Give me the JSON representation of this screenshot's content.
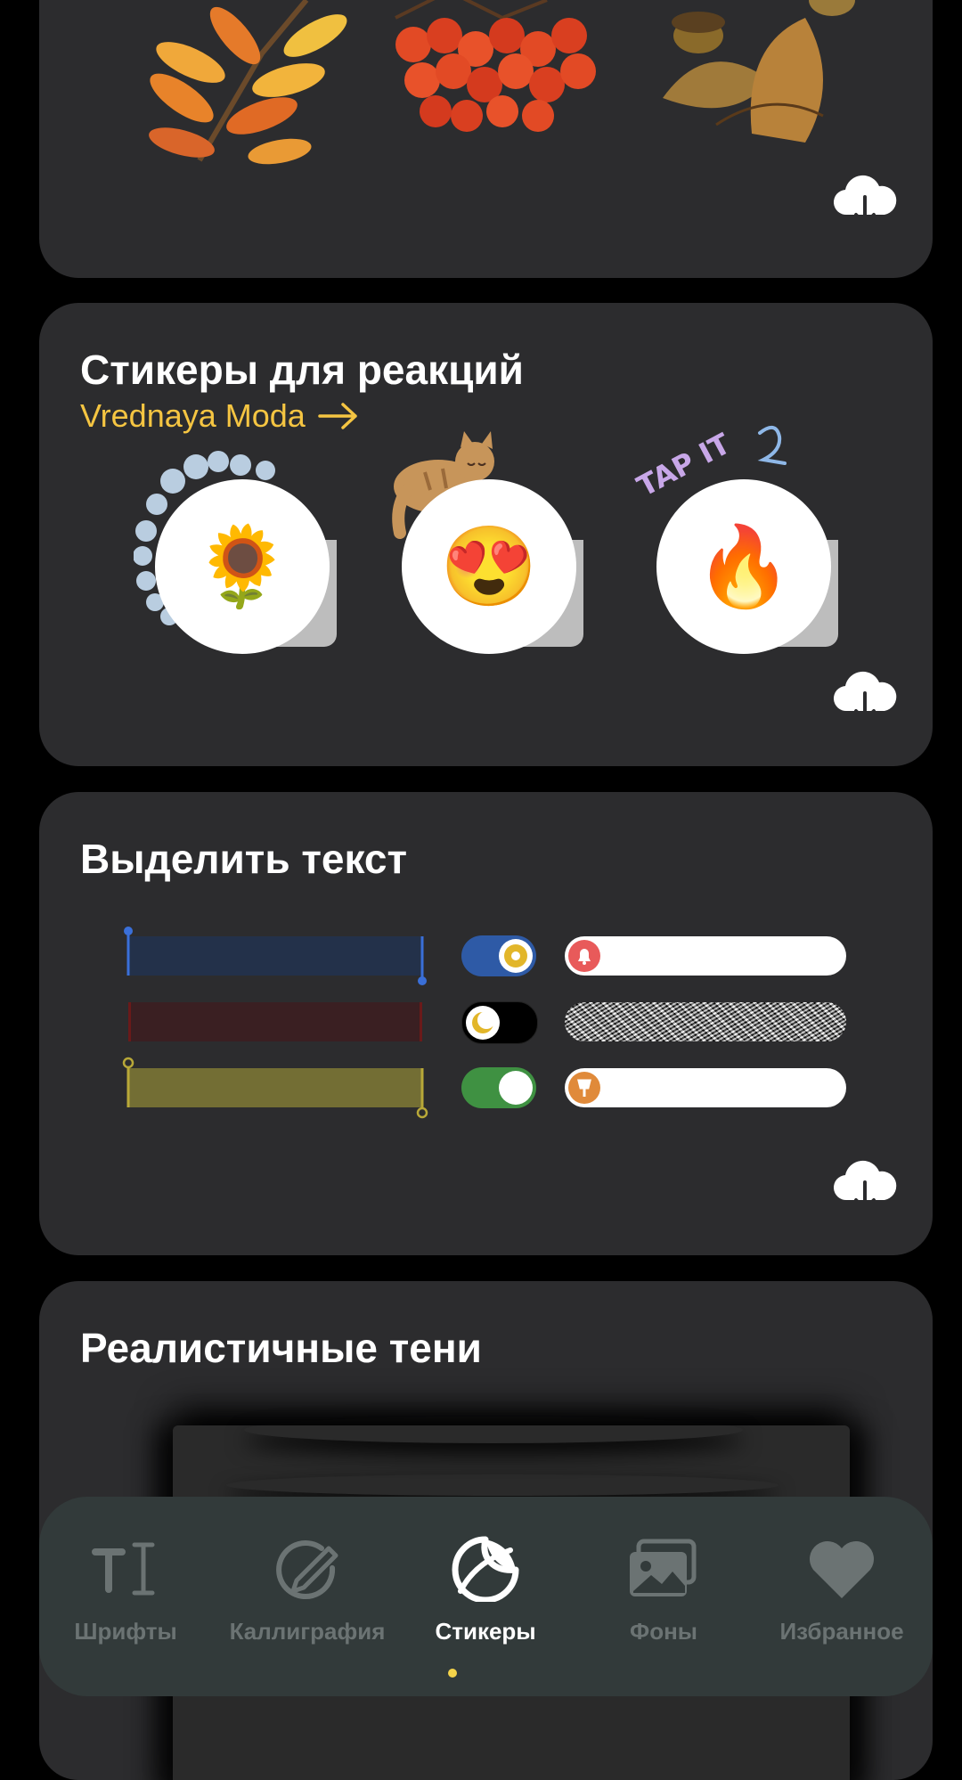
{
  "colors": {
    "background": "#000000",
    "card": "#2c2c2e",
    "accent": "#f5c542",
    "tabbar": "#323a3a",
    "tab_inactive": "#6b7373"
  },
  "cards": {
    "autumn": {
      "illustration_icons": [
        "leaf-branch-icon",
        "rowan-berries-icon",
        "oak-leaves-acorns-icon"
      ]
    },
    "reactions": {
      "title": "Стикеры для реакций",
      "author": "Vrednaya Moda",
      "deco_text": "TAP IT",
      "reactions": [
        {
          "emoji": "🌻",
          "name": "sunflower"
        },
        {
          "emoji": "😍",
          "name": "heart-eyes"
        },
        {
          "emoji": "🔥",
          "name": "fire"
        }
      ]
    },
    "highlight": {
      "title": "Выделить текст",
      "bar_colors": [
        "#23314a",
        "#3a1f22",
        "#736e34"
      ],
      "toggles": [
        {
          "state": "on",
          "color": "#2e5aa6",
          "icon": "sun-icon"
        },
        {
          "state": "off",
          "color": "#000000",
          "icon": "moon-icon"
        },
        {
          "state": "on",
          "color": "#3f9142",
          "icon": ""
        }
      ],
      "pills": [
        {
          "icon": "bell-icon",
          "dot_color": "#e85a5a"
        },
        {
          "icon": "",
          "style": "noise"
        },
        {
          "icon": "pin-icon",
          "dot_color": "#e08a3a"
        }
      ]
    },
    "shadows": {
      "title": "Реалистичные тени"
    }
  },
  "tabbar": {
    "tabs": [
      {
        "label": "Шрифты",
        "icon": "text-size-icon",
        "active": false
      },
      {
        "label": "Каллиграфия",
        "icon": "pen-circle-icon",
        "active": false
      },
      {
        "label": "Стикеры",
        "icon": "sticker-icon",
        "active": true
      },
      {
        "label": "Фоны",
        "icon": "photos-icon",
        "active": false
      },
      {
        "label": "Избранное",
        "icon": "heart-icon",
        "active": false
      }
    ]
  }
}
